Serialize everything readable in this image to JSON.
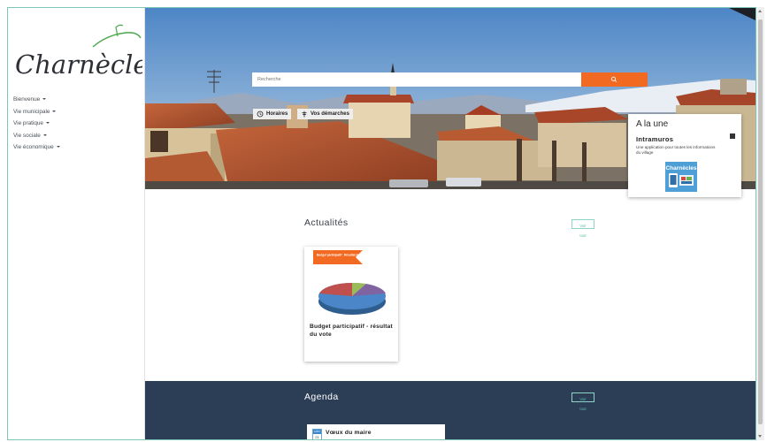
{
  "site": {
    "logo_text": "Charnècles"
  },
  "nav": {
    "items": [
      {
        "label": "Bienvenue"
      },
      {
        "label": "Vie municipale"
      },
      {
        "label": "Vie pratique"
      },
      {
        "label": "Vie sociale"
      },
      {
        "label": "Vie économique"
      }
    ]
  },
  "hero": {
    "search_placeholder": "Recherche",
    "search_icon": "search-icon",
    "quick_links": [
      {
        "label": "Horaires",
        "icon": "clock-icon"
      },
      {
        "label": "Vos démarches",
        "icon": "signpost-icon"
      }
    ]
  },
  "alaune": {
    "heading": "A la une",
    "title": "Intramuros",
    "description": "Une application pour toutes les informations du village",
    "thumb_text": "Charnècles"
  },
  "actualites": {
    "heading": "Actualités",
    "see_all": "Voir tout",
    "cards": [
      {
        "title": "Budget participatif - résultat du vote",
        "image_banner": "Budget participatif : Résultat des votes"
      }
    ]
  },
  "agenda": {
    "heading": "Agenda",
    "see_all": "Voir tout",
    "events": [
      {
        "month": "JANV",
        "day": "21",
        "title": "Vœux du maire"
      }
    ]
  },
  "colors": {
    "accent": "#f26a21",
    "frame": "#7cc7b8",
    "agenda_bg": "#2c3e56",
    "logo_green": "#4aa64a"
  }
}
